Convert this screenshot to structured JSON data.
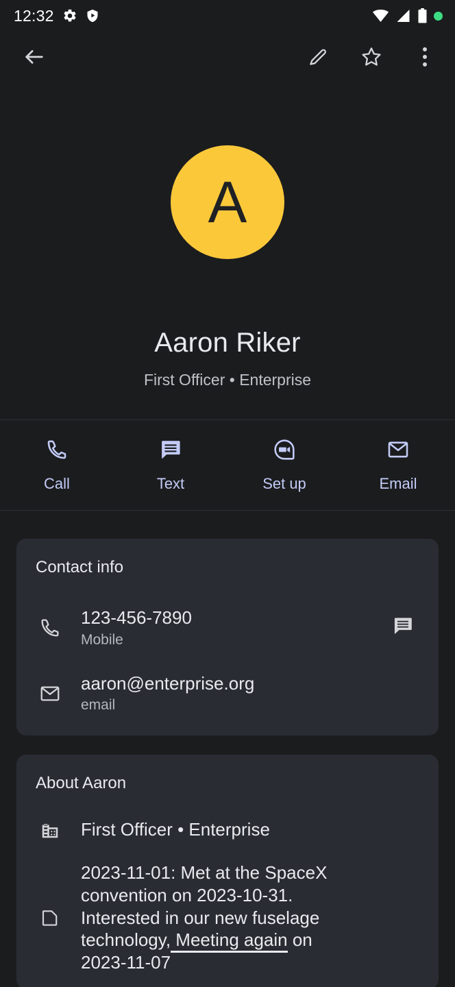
{
  "statusbar": {
    "time": "12:32",
    "left_icons": [
      "settings-gear-icon",
      "shield-play-icon"
    ],
    "right_icons": [
      "wifi-icon",
      "cellular-signal-icon",
      "battery-icon",
      "privacy-indicator-dot"
    ],
    "privacy_dot_color": "#3ddc84"
  },
  "toolbar": {
    "back_label": "Back",
    "edit_label": "Edit contact",
    "star_label": "Add to favorites",
    "more_label": "More options"
  },
  "contact": {
    "avatar_letter": "A",
    "avatar_color": "#fbc83a",
    "name": "Aaron Riker",
    "subtitle": "First Officer • Enterprise"
  },
  "quick_actions": [
    {
      "label": "Call",
      "icon": "phone-icon"
    },
    {
      "label": "Text",
      "icon": "message-icon"
    },
    {
      "label": "Set up",
      "icon": "video-call-icon"
    },
    {
      "label": "Email",
      "icon": "email-icon"
    }
  ],
  "contact_info": {
    "title": "Contact info",
    "phone": {
      "value": "123-456-7890",
      "label": "Mobile",
      "icon": "phone-icon",
      "action_icon": "message-icon"
    },
    "email": {
      "value": "aaron@enterprise.org",
      "label": "email",
      "icon": "email-icon"
    }
  },
  "about": {
    "title": "About Aaron",
    "organization": {
      "value": "First Officer • Enterprise",
      "icon": "building-icon"
    },
    "note": {
      "icon": "note-icon",
      "line1": "2023-11-01: Met at the SpaceX",
      "line2": "convention on 2023-10-31.",
      "line3": "Interested in our new fuselage",
      "line4_before": "technology,",
      "line4_highlight": " Meeting again",
      "line4_after": " on",
      "line5": "2023-11-07"
    }
  },
  "colors": {
    "page_background": "#1b1c1e",
    "card_background": "#292c32",
    "accent": "#c3cbf7",
    "primary_text": "#e8eaee",
    "secondary_text": "#b5b8bd"
  }
}
